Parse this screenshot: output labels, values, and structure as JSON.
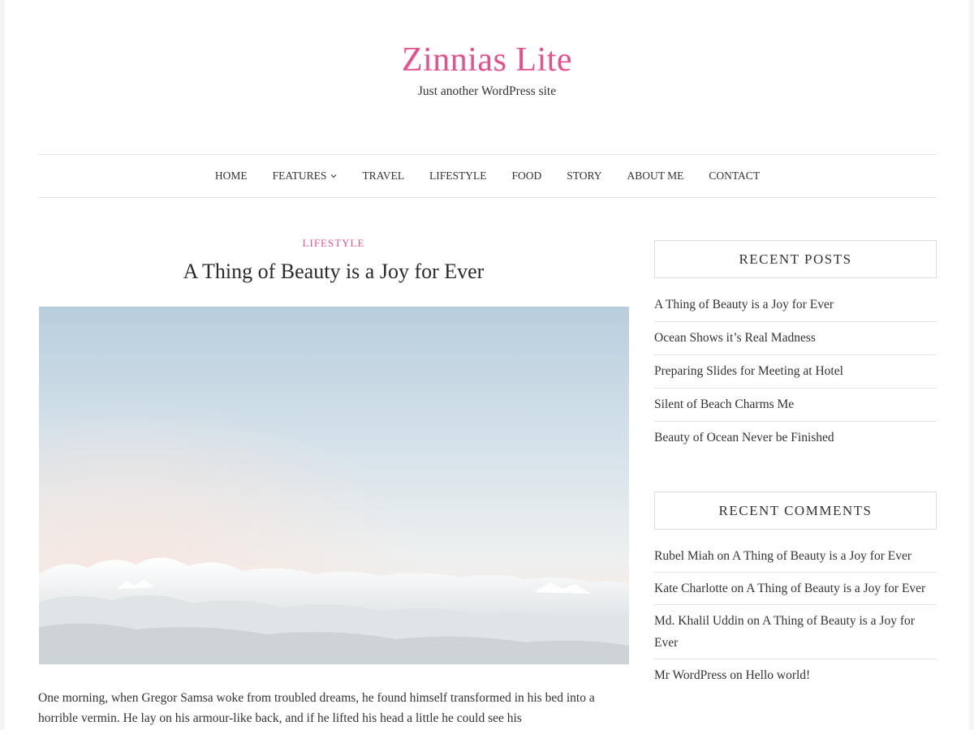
{
  "site": {
    "title": "Zinnias Lite",
    "description": "Just another WordPress site",
    "accent_color": "#e5508f"
  },
  "nav": {
    "items": [
      {
        "label": "HOME"
      },
      {
        "label": "FEATURES",
        "has_dropdown": true,
        "icon": "chevron-down-icon"
      },
      {
        "label": "TRAVEL"
      },
      {
        "label": "LIFESTYLE"
      },
      {
        "label": "FOOD"
      },
      {
        "label": "STORY"
      },
      {
        "label": "ABOUT ME"
      },
      {
        "label": "CONTACT"
      }
    ]
  },
  "post": {
    "category": "LIFESTYLE",
    "title": "A Thing of Beauty is a Joy for Ever",
    "image_description": "sky-above-clouds",
    "excerpt": "One morning, when Gregor Samsa woke from troubled dreams, he found himself transformed in his bed into a horrible vermin. He lay on his armour-like back, and if he lifted his head a little he could see his"
  },
  "sidebar": {
    "recent_posts": {
      "title": "RECENT POSTS",
      "items": [
        "A Thing of Beauty is a Joy for Ever",
        "Ocean Shows it’s Real Madness",
        "Preparing Slides for Meeting at Hotel",
        "Silent of Beach Charms Me",
        "Beauty of Ocean Never be Finished"
      ]
    },
    "recent_comments": {
      "title": "RECENT COMMENTS",
      "connector": "on",
      "items": [
        {
          "author": "Rubel Miah",
          "post": "A Thing of Beauty is a Joy for Ever"
        },
        {
          "author": "Kate Charlotte",
          "post": "A Thing of Beauty is a Joy for Ever"
        },
        {
          "author": "Md. Khalil Uddin",
          "post": "A Thing of Beauty is a Joy for Ever"
        },
        {
          "author": "Mr WordPress",
          "post": "Hello world!"
        }
      ]
    }
  }
}
